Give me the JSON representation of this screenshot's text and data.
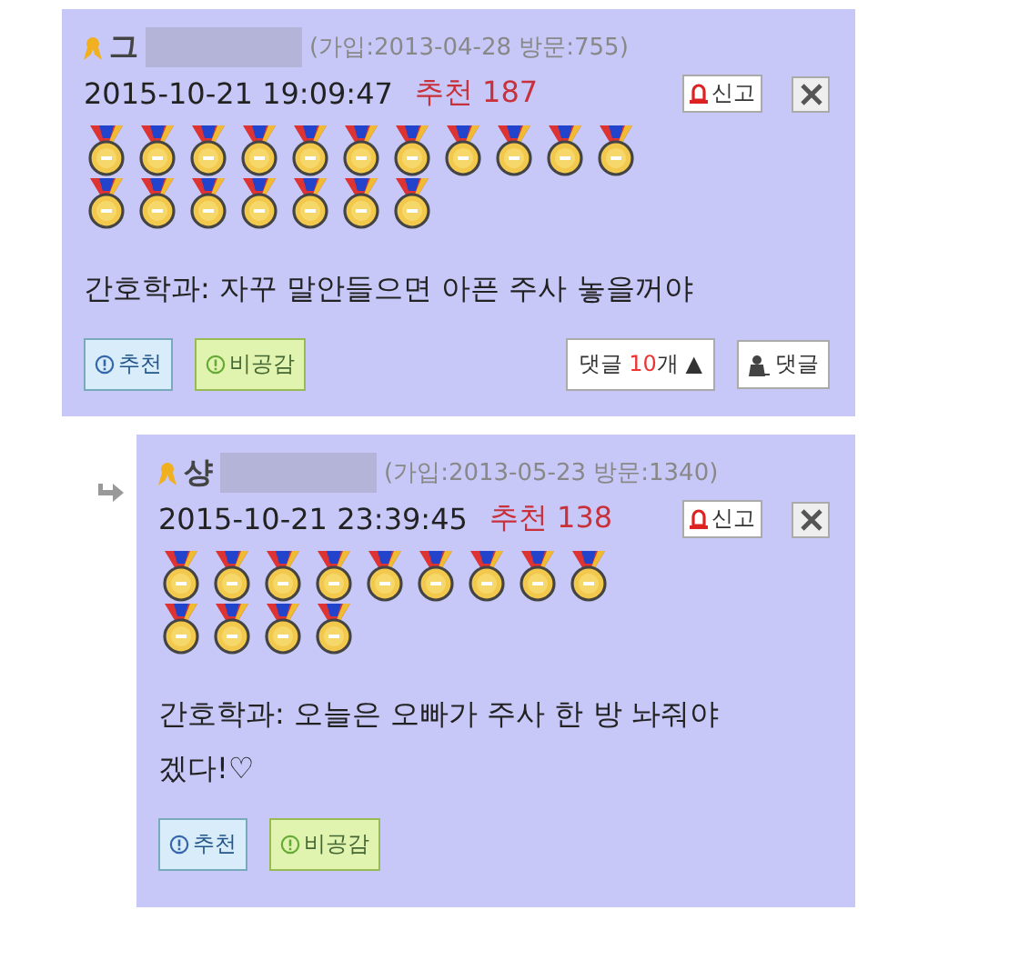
{
  "comments": [
    {
      "reply": false,
      "name": "그",
      "joined": "(가입:2013-04-28 방문:755)",
      "datetime": "2015-10-21 19:09:47",
      "recommend": "추천 187",
      "report": "신고",
      "medals": [
        {
          "kind": "gold"
        },
        {
          "kind": "gold"
        },
        {
          "kind": "gold"
        },
        {
          "kind": "gold"
        },
        {
          "kind": "gold"
        },
        {
          "kind": "gold"
        },
        {
          "kind": "gold"
        },
        {
          "kind": "gold"
        },
        {
          "kind": "gold"
        },
        {
          "kind": "gold"
        },
        {
          "kind": "gold"
        },
        {
          "kind": "gold"
        },
        {
          "kind": "gold"
        },
        {
          "kind": "gold"
        },
        {
          "kind": "gold"
        },
        {
          "kind": "gold"
        },
        {
          "kind": "gold"
        },
        {
          "kind": "gold"
        }
      ],
      "text": "간호학과: 자꾸 말안들으면 아픈 주사 놓을꺼야",
      "like": "추천",
      "dislike": "비공감",
      "replies_label": "댓글",
      "replies_count": "10",
      "replies_unit": "개",
      "replies_arrow": "▲",
      "write_reply": "댓글"
    },
    {
      "reply": true,
      "name": "샹",
      "joined": "(가입:2013-05-23 방문:1340)",
      "datetime": "2015-10-21 23:39:45",
      "recommend": "추천 138",
      "report": "신고",
      "medals": [
        {
          "kind": "gold"
        },
        {
          "kind": "gold"
        },
        {
          "kind": "gold"
        },
        {
          "kind": "gold"
        },
        {
          "kind": "gold"
        },
        {
          "kind": "gold"
        },
        {
          "kind": "gold"
        },
        {
          "kind": "gold"
        },
        {
          "kind": "gold"
        },
        {
          "kind": "gold"
        },
        {
          "kind": "gold"
        },
        {
          "kind": "gold"
        },
        {
          "kind": "gold"
        }
      ],
      "text": "간호학과: 오늘은 오빠가 주사 한 방 놔줘야 겠다!♡",
      "like": "추천",
      "dislike": "비공감"
    }
  ]
}
